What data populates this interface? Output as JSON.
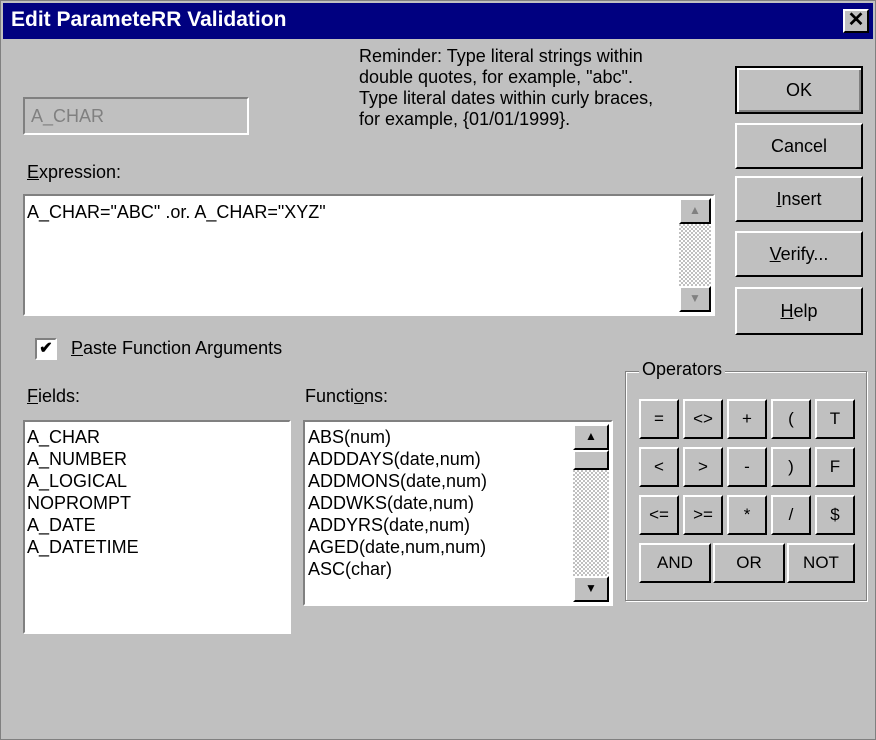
{
  "window": {
    "title": "Edit ParameteRR Validation",
    "close_glyph": "✕"
  },
  "name_field": {
    "value": "A_CHAR"
  },
  "reminder": {
    "lines": [
      "Reminder: Type literal strings within",
      "double quotes, for example, \"abc\".",
      "Type literal dates within curly braces,",
      "for example, {01/01/1999}."
    ]
  },
  "expression": {
    "label_mnemonic": "E",
    "label_rest": "xpression:",
    "value": "A_CHAR=\"ABC\" .or. A_CHAR=\"XYZ\""
  },
  "buttons": {
    "ok": "OK",
    "cancel": "Cancel",
    "insert_mnemonic": "I",
    "insert_rest": "nsert",
    "verify_mnemonic": "V",
    "verify_rest": "erify...",
    "help_mnemonic": "H",
    "help_rest": "elp"
  },
  "paste_args": {
    "checked": true,
    "check_glyph": "✔",
    "label_mnemonic": "P",
    "label_rest": "aste Function Arguments"
  },
  "fields": {
    "label_mnemonic": "F",
    "label_rest": "ields:",
    "items": [
      "A_CHAR",
      "A_NUMBER",
      "A_LOGICAL",
      "NOPROMPT",
      "A_DATE",
      "A_DATETIME"
    ]
  },
  "functions": {
    "label_pre": "Functi",
    "label_mnemonic": "o",
    "label_post": "ns:",
    "items": [
      "ABS(num)",
      "ADDDAYS(date,num)",
      "ADDMONS(date,num)",
      "ADDWKS(date,num)",
      "ADDYRS(date,num)",
      "AGED(date,num,num)",
      "ASC(char)"
    ]
  },
  "operators": {
    "title": "Operators",
    "row1": [
      "=",
      "<>",
      "+",
      "(",
      "T"
    ],
    "row2": [
      "<",
      ">",
      "-",
      ")",
      "F"
    ],
    "row3": [
      "<=",
      ">=",
      "*",
      "/",
      "$"
    ],
    "row4": [
      "AND",
      "OR",
      "NOT"
    ]
  },
  "scroll_glyphs": {
    "up": "▲",
    "down": "▼"
  }
}
